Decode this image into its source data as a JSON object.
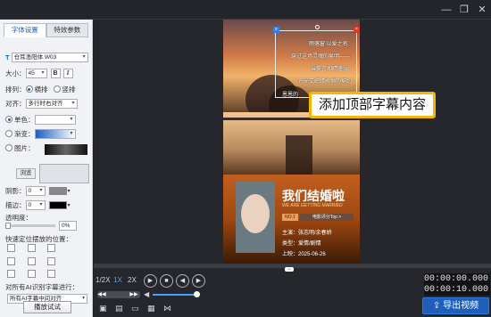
{
  "titlebar": {
    "minimize_icon": "minimize-icon",
    "maximize_icon": "maximize-icon",
    "close_icon": "close-icon"
  },
  "left_panel": {
    "tabs": [
      {
        "label": "字体设置"
      },
      {
        "label": "特效参数"
      }
    ],
    "font": {
      "name": "仓耳渔阳体 W03"
    },
    "size": {
      "label": "大小：",
      "value": "45",
      "bold": "B",
      "italic": "I"
    },
    "arrange": {
      "label": "排列：",
      "option1": "横排",
      "option2": "竖排"
    },
    "align": {
      "label": "对齐：",
      "value": "多行时右对齐"
    },
    "single_color": {
      "label": "单色："
    },
    "gradient": {
      "label": "渐变："
    },
    "image": {
      "label": "图片：",
      "browse": "浏览"
    },
    "shadow": {
      "label": "阴影：",
      "value": "0"
    },
    "stroke": {
      "label": "描边：",
      "value": "0"
    },
    "opacity": {
      "label": "透明度：",
      "value": "0%"
    },
    "quick_pos": {
      "label": "快速定位摆放的位置："
    },
    "ai": {
      "label": "对所有AI识别字幕进行：",
      "value": "所有AI字幕中间对齐"
    },
    "preview": {
      "label": "播放试试"
    }
  },
  "video": {
    "subtitles": [
      "雨落窗 以爱之名",
      "穿过这场灵魂的易明——",
      "当誓言如晴盛溢",
      "许光交织缘永恒的契约",
      "恩恩的"
    ],
    "poster_title": "我们结婚啦",
    "poster_sub": "WE ARE GETTING MARRIED",
    "badge1": "NO.1",
    "badge2": "电影评分Top >",
    "cast": "主演：张志明/余春娇",
    "genre": "类型：爱情/剧情",
    "date": "上映：2025-06-26"
  },
  "tooltip": {
    "text": "添加顶部字幕内容"
  },
  "timeline": {
    "speeds": [
      "1/2X",
      "1X",
      "2X"
    ],
    "time_current": "00:00:00.000",
    "time_total": "00:00:10.000",
    "export": "导出视频"
  },
  "colors": {
    "accent": "#1d5fb9",
    "tooltip_border": "#f5b700"
  }
}
